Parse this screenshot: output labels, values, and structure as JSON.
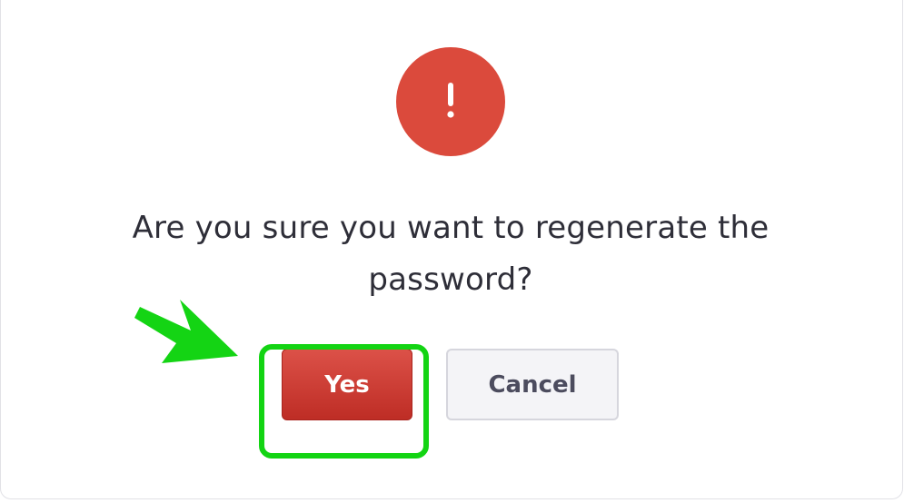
{
  "dialog": {
    "icon": "exclamation-icon",
    "message": "Are you sure you want to regenerate the password?",
    "confirm_label": "Yes",
    "cancel_label": "Cancel"
  },
  "annotation": {
    "arrow_icon": "green-arrow-icon",
    "highlight_color": "#13d413"
  },
  "colors": {
    "danger": "#db4a3c",
    "confirm_button": "#c83a31",
    "cancel_button": "#f4f4f7",
    "text": "#2e2e38"
  }
}
